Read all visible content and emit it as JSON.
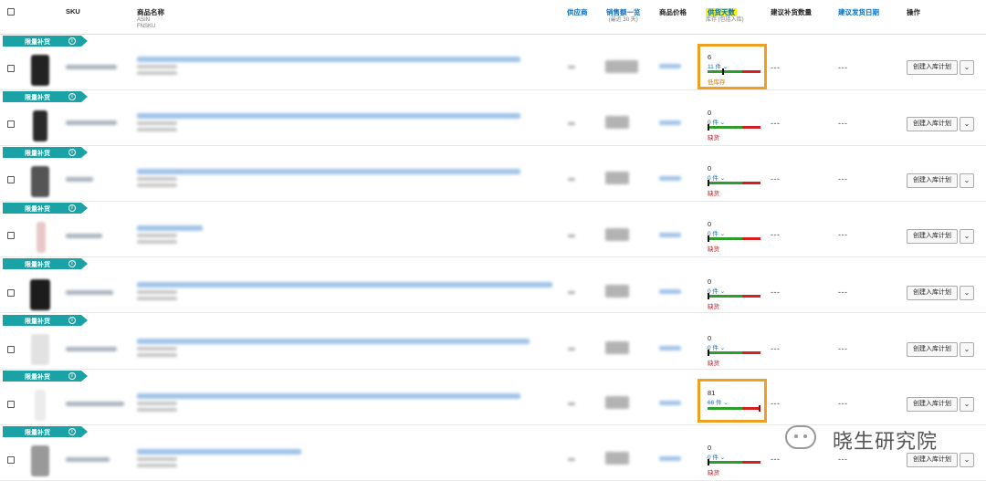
{
  "header": {
    "sku": "SKU",
    "product_name": "商品名称",
    "asin": "ASIN",
    "fnsku": "FNSKU",
    "supplier": "供应商",
    "sales_1": "销售额一览",
    "sales_2": "(最近 30 天)",
    "price": "商品价格",
    "supply_days": "供货天数",
    "supply_days_sub": "库存 (包括入库)",
    "restock_qty": "建议补货数量",
    "ship_date": "建议发货日期",
    "action": "操作"
  },
  "rows": [
    {
      "tag": "限量补货",
      "days": "6",
      "qty": "11 件",
      "status": "低库存",
      "dots": "---",
      "btn": "创建入库计划"
    },
    {
      "tag": "限量补货",
      "days": "0",
      "qty": "0 件",
      "status": "缺货",
      "dots": "---",
      "btn": "创建入库计划"
    },
    {
      "tag": "限量补货",
      "days": "0",
      "qty": "0 件",
      "status": "缺货",
      "dots": "---",
      "btn": "创建入库计划"
    },
    {
      "tag": "限量补货",
      "days": "0",
      "qty": "0 件",
      "status": "缺货",
      "dots": "---",
      "btn": "创建入库计划"
    },
    {
      "tag": "限量补货",
      "days": "0",
      "qty": "0 件",
      "status": "缺货",
      "dots": "---",
      "btn": "创建入库计划"
    },
    {
      "tag": "限量补货",
      "days": "0",
      "qty": "0 件",
      "status": "缺货",
      "dots": "---",
      "btn": "创建入库计划"
    },
    {
      "tag": "限量补货",
      "days": "81",
      "qty": "66 件",
      "status": "",
      "dots": "---",
      "btn": "创建入库计划"
    },
    {
      "tag": "限量补货",
      "days": "0",
      "qty": "0 件",
      "status": "缺货",
      "dots": "---",
      "btn": "创建入库计划"
    }
  ],
  "supply_levels": [
    0.28,
    0,
    0,
    0,
    0,
    0,
    1.0,
    0
  ],
  "watermark": "晓生研究院",
  "colors": {
    "tag": "#1aa2a6",
    "highlight_box": "#f0a020",
    "bar_green": "#2e9d2e",
    "bar_red": "#d42020",
    "low_stock": "#e07a00",
    "out_of_stock": "#c0141c",
    "link": "#0a6ebd"
  }
}
